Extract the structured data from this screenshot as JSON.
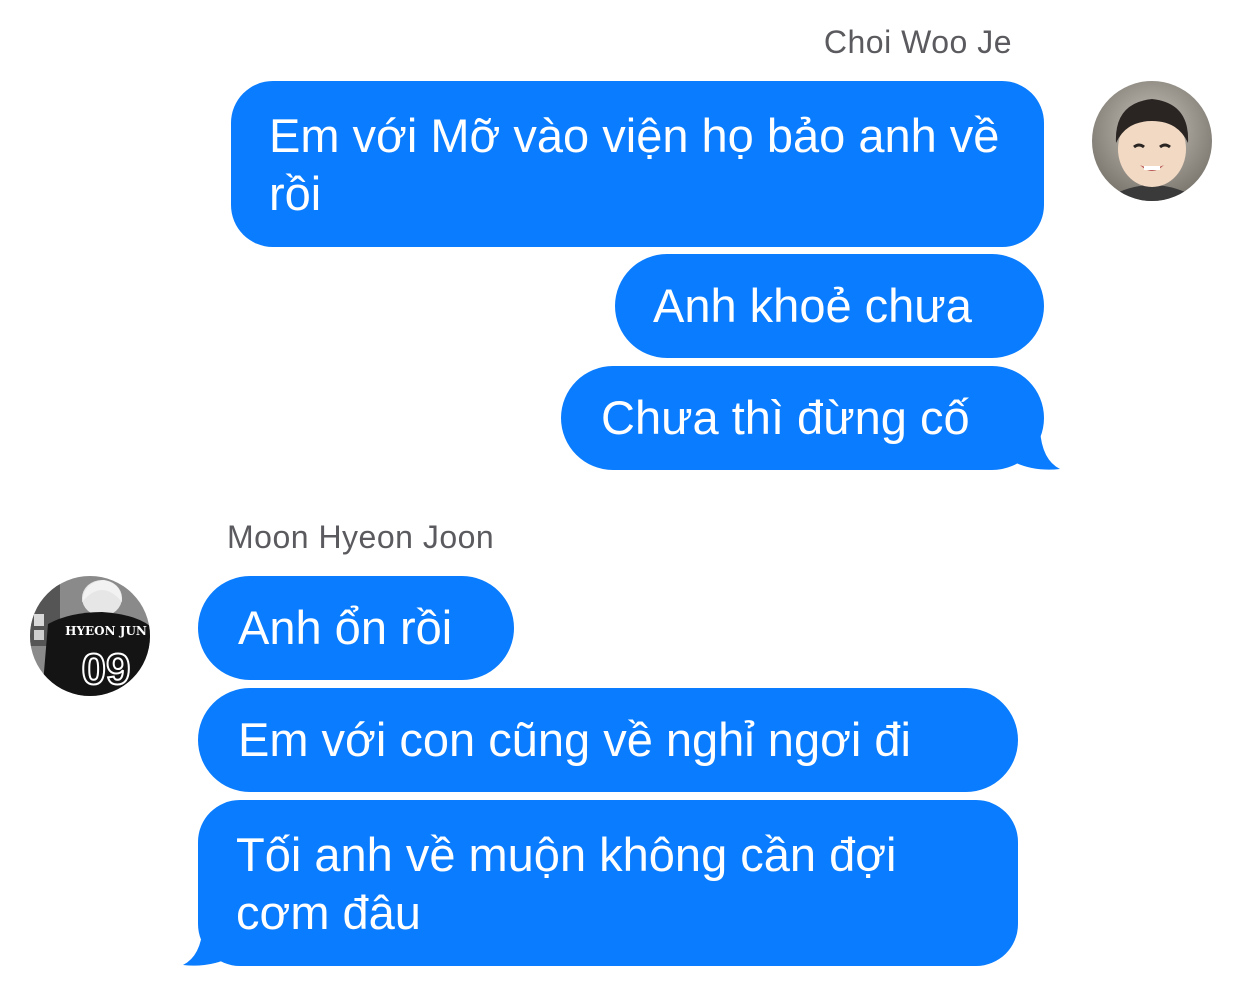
{
  "conversation": {
    "groups": [
      {
        "sender": "Choi Woo Je",
        "side": "outgoing",
        "messages": [
          "Em với Mỡ vào viện họ bảo anh về rồi",
          "Anh khoẻ chưa",
          "Chưa thì đừng cố"
        ]
      },
      {
        "sender": "Moon Hyeon Joon",
        "side": "incoming",
        "messages": [
          "Anh ổn rồi",
          "Em với con cũng về nghỉ ngơi đi",
          "Tối anh về muộn không cần đợi cơm đâu"
        ]
      }
    ],
    "jersey": {
      "name": "HYEON JUN",
      "number": "09"
    },
    "colors": {
      "bubble": "#0a7cff",
      "bubble_text": "#ffffff",
      "sender_name": "#5b5b5f",
      "background": "#ffffff"
    },
    "avatar_icons": [
      "child-photo-avatar",
      "jersey-photo-avatar"
    ]
  }
}
